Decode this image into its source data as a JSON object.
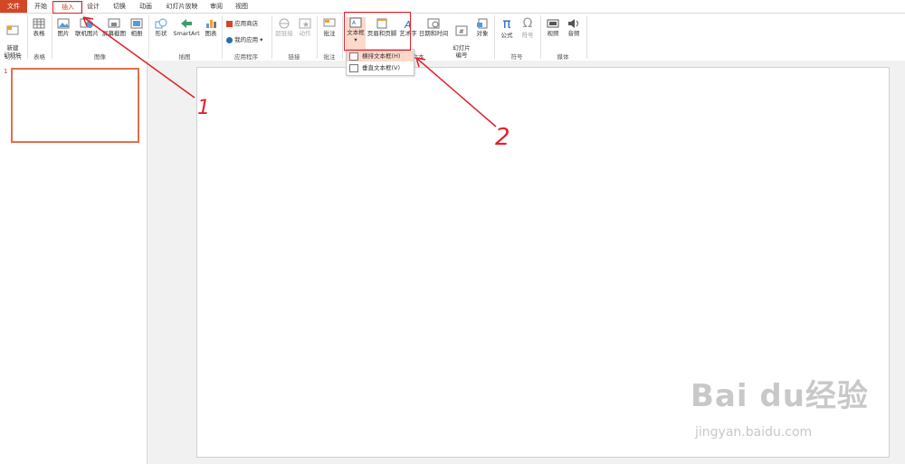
{
  "tabs": [
    {
      "label": "文件"
    },
    {
      "label": "开始"
    },
    {
      "label": "插入"
    },
    {
      "label": "设计"
    },
    {
      "label": "切换"
    },
    {
      "label": "动画"
    },
    {
      "label": "幻灯片放映"
    },
    {
      "label": "审阅"
    },
    {
      "label": "视图"
    }
  ],
  "ribbon": {
    "slides": {
      "new_slide": "新建\n幻灯片",
      "group": "幻灯片"
    },
    "tables": {
      "table": "表格",
      "group": "表格"
    },
    "images": {
      "picture": "图片",
      "online_picture": "联机图片",
      "screenshot": "屏幕截图",
      "album": "相册",
      "group": "图像"
    },
    "illustrations": {
      "shapes": "形状",
      "smartart": "SmartArt",
      "chart": "图表",
      "group": "插图"
    },
    "apps": {
      "store": "应用商店",
      "my_apps": "我的应用",
      "group": "应用程序"
    },
    "links": {
      "hyperlink": "超链接",
      "action": "动作",
      "group": "链接"
    },
    "comments": {
      "comment": "批注",
      "group": "批注"
    },
    "text": {
      "textbox": "文本框",
      "header_footer": "页眉和页脚",
      "wordart": "艺术字",
      "datetime": "日期和时间",
      "slide_number": "幻灯片\n编号",
      "object": "对象",
      "group": "文本"
    },
    "symbols": {
      "equation": "公式",
      "symbol": "符号",
      "group": "符号"
    },
    "media": {
      "video": "视频",
      "audio": "音频",
      "group": "媒体"
    }
  },
  "dropdown": {
    "items": [
      {
        "label": "横排文本框(H)"
      },
      {
        "label": "垂直文本框(V)"
      }
    ]
  },
  "slide_panel": {
    "number": "1"
  },
  "annotations": {
    "one": "1",
    "two": "2"
  },
  "watermark": {
    "brand": "Bai du",
    "brand_cn": "经验",
    "url": "jingyan.baidu.com"
  },
  "colors": {
    "accent": "#d24726",
    "annotation_red": "#e2202a"
  }
}
